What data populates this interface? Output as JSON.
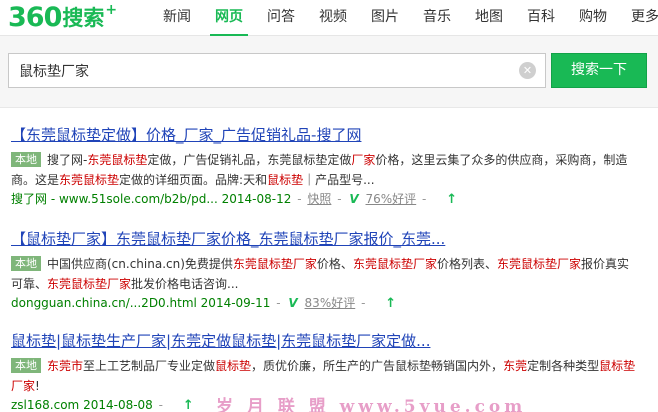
{
  "logo": {
    "brand": "360",
    "name": "搜索",
    "plus": "+"
  },
  "nav": {
    "items": [
      "新闻",
      "网页",
      "问答",
      "视频",
      "图片",
      "音乐",
      "地图",
      "百科",
      "购物",
      "更多"
    ],
    "active": "网页",
    "more_caret": "▾"
  },
  "search": {
    "query": "鼠标垫厂家",
    "clear_glyph": "✕",
    "button_label": "搜索一下"
  },
  "accent_color": "#19b955",
  "results": [
    {
      "title_parts": [
        {
          "text": "【",
          "hl": false
        },
        {
          "text": "东莞鼠标垫定做",
          "hl": false
        },
        {
          "text": "】价格_厂家_广告促销礼品-搜了网",
          "hl": false
        }
      ],
      "badge": "本地",
      "snippet_parts": [
        {
          "text": "搜了网-",
          "hl": false
        },
        {
          "text": "东莞鼠标垫",
          "hl": true
        },
        {
          "text": "定做，广告促销礼品，东莞鼠标垫定做",
          "hl": false
        },
        {
          "text": "厂家",
          "hl": true
        },
        {
          "text": "价格，这里云集了众多的供应商，采购商，制造商。这是",
          "hl": false
        },
        {
          "text": "东莞鼠标垫",
          "hl": true
        },
        {
          "text": "定做的详细页面。品牌:天和",
          "hl": false
        },
        {
          "text": "鼠标垫",
          "hl": true
        },
        {
          "text": "｜产品型号...",
          "hl": false
        }
      ],
      "meta": {
        "site": "搜了网 - www.51sole.com/b2b/pd...",
        "date": "2014-08-12",
        "sep": "-",
        "snapshot": "快照",
        "v": "V",
        "rating": "76%好评",
        "up": "↑"
      }
    },
    {
      "title_parts": [
        {
          "text": "【鼠标垫厂家】东莞鼠标垫厂家价格_东莞鼠标垫厂家报价_东莞...",
          "hl": false
        }
      ],
      "badge": "本地",
      "snippet_parts": [
        {
          "text": "中国供应商(cn.china.cn)免费提供",
          "hl": false
        },
        {
          "text": "东莞鼠标垫厂家",
          "hl": true
        },
        {
          "text": "价格、",
          "hl": false
        },
        {
          "text": "东莞鼠标垫厂家",
          "hl": true
        },
        {
          "text": "价格列表、",
          "hl": false
        },
        {
          "text": "东莞鼠标垫厂家",
          "hl": true
        },
        {
          "text": "报价真实可靠、",
          "hl": false
        },
        {
          "text": "东莞鼠标垫厂家",
          "hl": true
        },
        {
          "text": "批发价格电话咨询...",
          "hl": false
        }
      ],
      "meta": {
        "site": "dongguan.china.cn/...2D0.html",
        "date": "2014-09-11",
        "sep": "-",
        "v": "V",
        "rating": "83%好评",
        "up": "↑"
      }
    },
    {
      "title_parts": [
        {
          "text": "鼠标垫|鼠标垫生产厂家|东莞定做鼠标垫|东莞鼠标垫厂家定做...",
          "hl": false
        }
      ],
      "badge": "本地",
      "snippet_parts": [
        {
          "text": "东莞市",
          "hl": true
        },
        {
          "text": "至上工艺制品厂专业定做",
          "hl": false
        },
        {
          "text": "鼠标垫",
          "hl": true
        },
        {
          "text": "，质优价廉，所生产的广告鼠标垫畅销国内外，",
          "hl": false
        },
        {
          "text": "东莞",
          "hl": true
        },
        {
          "text": "定制各种类型",
          "hl": false
        },
        {
          "text": "鼠标垫厂家",
          "hl": true
        },
        {
          "text": "!",
          "hl": false
        }
      ],
      "meta": {
        "site": "zsl",
        "site_tail": "168.com",
        "date": "2014-08-08",
        "sep": "-",
        "up": "↑"
      }
    }
  ],
  "watermark": "岁 月 联 盟  www.5yue.com"
}
